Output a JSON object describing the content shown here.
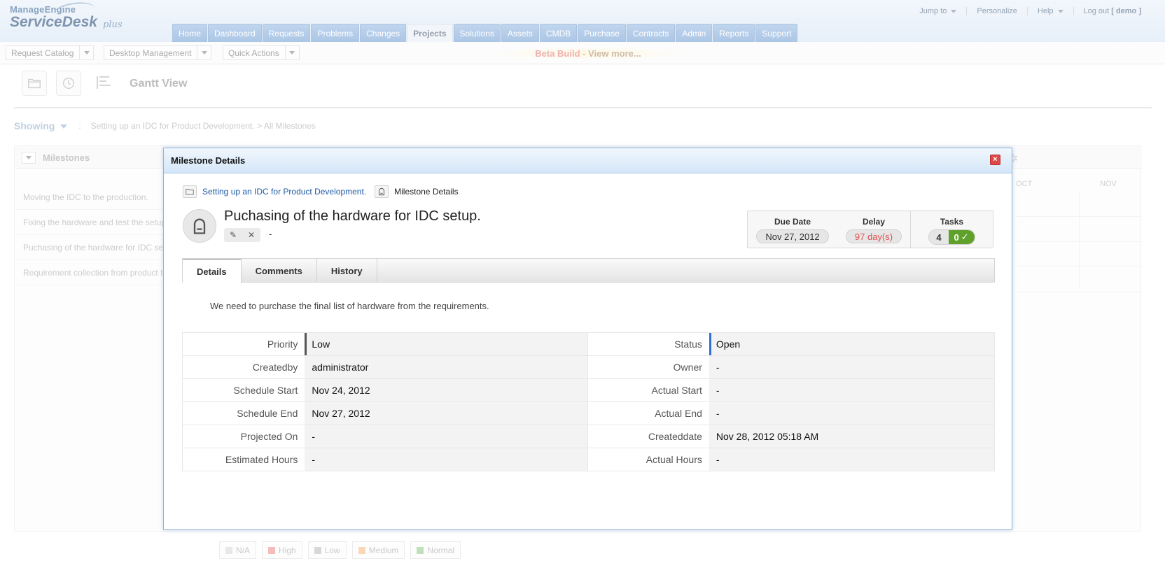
{
  "header": {
    "logo_top": "ManageEngine",
    "logo_main": "ServiceDesk",
    "logo_plus": "plus",
    "jump_to": "Jump to",
    "personalize": "Personalize",
    "help": "Help",
    "logout": "Log out",
    "user": "[ demo ]"
  },
  "nav": {
    "tabs": [
      "Home",
      "Dashboard",
      "Requests",
      "Problems",
      "Changes",
      "Projects",
      "Solutions",
      "Assets",
      "CMDB",
      "Purchase",
      "Contracts",
      "Admin",
      "Reports",
      "Support"
    ],
    "active": "Projects"
  },
  "subbar": {
    "request_catalog": "Request Catalog",
    "desktop_management": "Desktop Management",
    "quick_actions": "Quick Actions",
    "beta_build": "Beta Build",
    "view_more": " - View more..."
  },
  "page": {
    "title": "Gantt View",
    "showing_label": "Showing",
    "showing_sep": ":",
    "showing_path": "Setting up an IDC for Product Development.  >  All Milestones",
    "milestones_title": "Milestones",
    "milestones": [
      "Moving the IDC to the production.",
      "Fixing the hardware and test the setup.",
      "Puchasing of the hardware for IDC setup.",
      "Requirement collection from product team."
    ],
    "months": [
      "OCT",
      "NOV"
    ],
    "legend": [
      {
        "label": "N/A",
        "color": "#e0e0e0"
      },
      {
        "label": "High",
        "color": "#f2a3a3"
      },
      {
        "label": "Low",
        "color": "#c9c9c9"
      },
      {
        "label": "Medium",
        "color": "#f7c89b"
      },
      {
        "label": "Normal",
        "color": "#a8d3a0"
      }
    ]
  },
  "modal": {
    "title": "Milestone Details",
    "close": "×",
    "breadcrumb_project": "Setting up an IDC for Product Development.",
    "breadcrumb_current": "Milestone Details",
    "heading": "Puchasing of the hardware for IDC setup.",
    "heading_sub": "-",
    "due_date_label": "Due Date",
    "due_date": "Nov 27, 2012",
    "delay_label": "Delay",
    "delay": "97 day(s)",
    "tasks_label": "Tasks",
    "tasks_total": "4",
    "tasks_done": "0",
    "tabs": [
      "Details",
      "Comments",
      "History"
    ],
    "active_tab": "Details",
    "description": "We need to purchase the final list of hardware from the requirements.",
    "fields": [
      {
        "l1": "Priority",
        "v1": "Low",
        "l2": "Status",
        "v2": "Open"
      },
      {
        "l1": "Createdby",
        "v1": "administrator",
        "l2": "Owner",
        "v2": "-"
      },
      {
        "l1": "Schedule Start",
        "v1": "Nov 24, 2012",
        "l2": "Actual Start",
        "v2": "-"
      },
      {
        "l1": "Schedule End",
        "v1": "Nov 27, 2012",
        "l2": "Actual End",
        "v2": "-"
      },
      {
        "l1": "Projected On",
        "v1": "-",
        "l2": "Createddate",
        "v2": "Nov 28, 2012 05:18 AM"
      },
      {
        "l1": "Estimated Hours",
        "v1": "-",
        "l2": "Actual Hours",
        "v2": "-"
      }
    ]
  }
}
